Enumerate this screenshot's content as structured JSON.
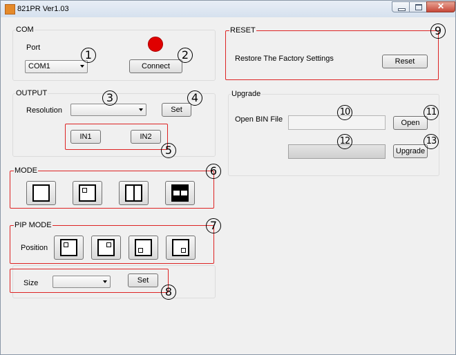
{
  "window": {
    "title": "821PR Ver1.03"
  },
  "com": {
    "group_label": "COM",
    "port_label": "Port",
    "port_value": "COM1",
    "connect_button": "Connect",
    "status_color": "#e00000"
  },
  "output": {
    "group_label": "OUTPUT",
    "resolution_label": "Resolution",
    "resolution_value": "",
    "set_button": "Set",
    "in1_button": "IN1",
    "in2_button": "IN2"
  },
  "mode": {
    "group_label": "MODE",
    "buttons": [
      "single-window-icon",
      "pip-icon",
      "split-vertical-icon",
      "side-by-side-icon"
    ]
  },
  "pip_mode": {
    "group_label": "PIP MODE",
    "position_label": "Position",
    "positions": [
      "pip-top-left-icon",
      "pip-top-right-icon",
      "pip-bottom-left-icon",
      "pip-bottom-right-icon"
    ],
    "size_label": "Size",
    "size_value": "",
    "set_button": "Set"
  },
  "reset": {
    "group_label": "RESET",
    "description": "Restore The Factory Settings",
    "reset_button": "Reset"
  },
  "upgrade": {
    "group_label": "Upgrade",
    "open_bin_label": "Open BIN File",
    "file_path": "",
    "open_button": "Open",
    "upgrade_button": "Upgrade",
    "progress": 0
  },
  "callouts": [
    "1",
    "2",
    "3",
    "4",
    "5",
    "6",
    "7",
    "8",
    "9",
    "10",
    "11",
    "12",
    "13"
  ],
  "colors": {
    "callout_box": "#dd2222",
    "window_bg": "#f0f0f0"
  }
}
